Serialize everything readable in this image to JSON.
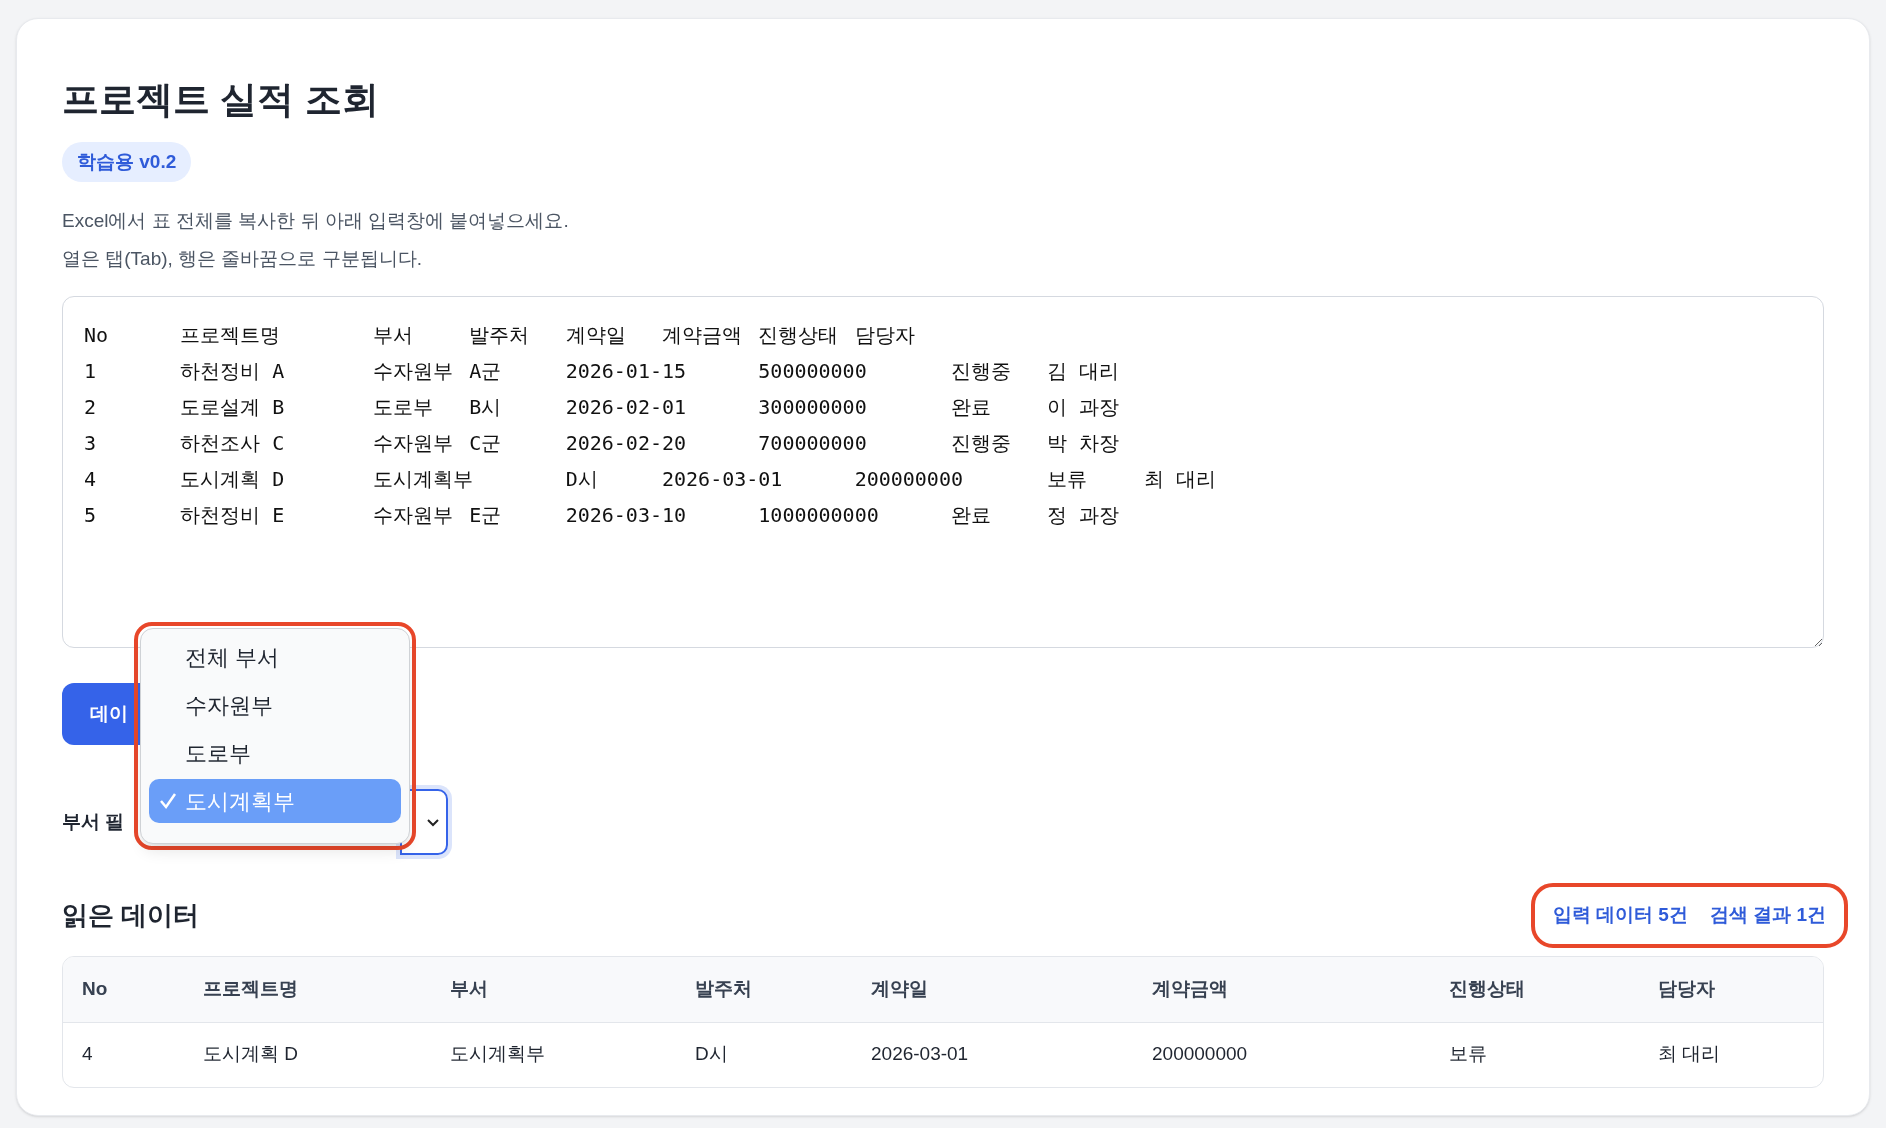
{
  "title": "프로젝트 실적 조회",
  "badge": "학습용 v0.2",
  "description": [
    "Excel에서 표 전체를 복사한 뒤 아래 입력창에 붙여넣으세요.",
    "열은 탭(Tab), 행은 줄바꿈으로 구분됩니다."
  ],
  "textarea": {
    "value": "No\t프로젝트명\t부서\t발주처\t계약일\t계약금액\t진행상태\t담당자\n1\t하천정비 A\t수자원부\tA군\t2026-01-15\t500000000\t진행중\t김 대리\n2\t도로설계 B\t도로부\tB시\t2026-02-01\t300000000\t완료\t이 과장\n3\t하천조사 C\t수자원부\tC군\t2026-02-20\t700000000\t진행중\t박 차장\n4\t도시계획 D\t도시계획부\tD시\t2026-03-01\t200000000\t보류\t최 대리\n5\t하천정비 E\t수자원부\tE군\t2026-03-10\t1000000000\t완료\t정 과장"
  },
  "read_button": "데이",
  "filter_label": "부서 필",
  "dropdown": {
    "options": [
      {
        "label": "전체 부서",
        "selected": false
      },
      {
        "label": "수자원부",
        "selected": false
      },
      {
        "label": "도로부",
        "selected": false
      },
      {
        "label": "도시계획부",
        "selected": true
      }
    ]
  },
  "section_title": "읽은 데이터",
  "counts": [
    "입력 데이터 5건",
    "검색 결과 1건"
  ],
  "table": {
    "columns": [
      "No",
      "프로젝트명",
      "부서",
      "발주처",
      "계약일",
      "계약금액",
      "진행상태",
      "담당자"
    ],
    "rows": [
      [
        "4",
        "도시계획 D",
        "도시계획부",
        "D시",
        "2026-03-01",
        "200000000",
        "보류",
        "최 대리"
      ]
    ]
  }
}
